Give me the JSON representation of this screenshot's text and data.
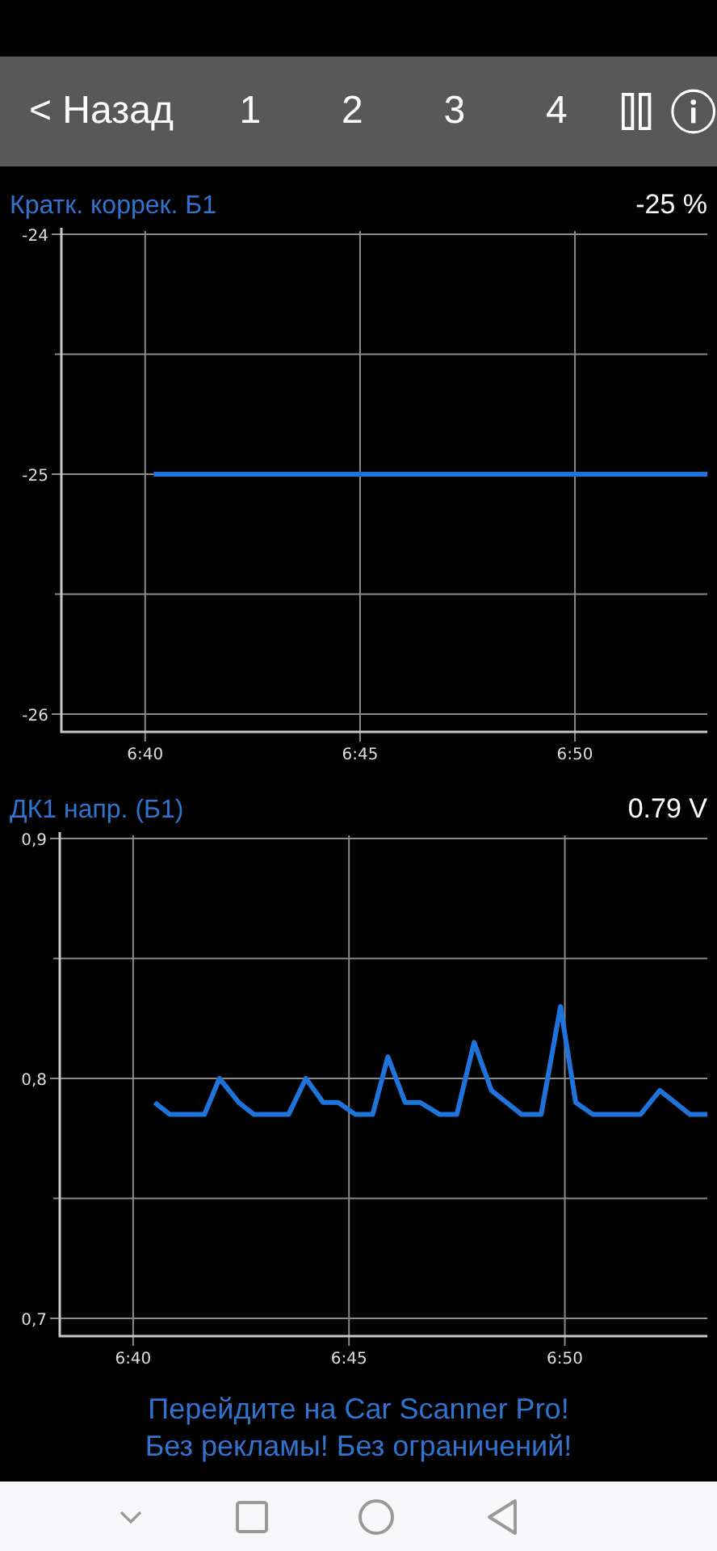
{
  "toolbar": {
    "back": "< Назад",
    "pages": [
      {
        "label": "1"
      },
      {
        "label": "2"
      },
      {
        "label": "3"
      },
      {
        "label": "4"
      }
    ]
  },
  "charts": [
    {
      "title": "Кратк. коррек. Б1",
      "reading": "-25 %",
      "chart_data": {
        "type": "line",
        "xlim": [
          398.05,
          413.08
        ],
        "ylim": [
          -26.074,
          -23.973
        ],
        "xticks": [
          {
            "value": 400,
            "label": "6:40"
          },
          {
            "value": 405,
            "label": "6:45"
          },
          {
            "value": 410,
            "label": "6:50"
          }
        ],
        "yticks": [
          {
            "value": -24,
            "label": "-24"
          },
          {
            "value": -25,
            "label": "-25"
          },
          {
            "value": -26,
            "label": "-26"
          }
        ],
        "x": [
          400.2,
          413.08
        ],
        "grid": true,
        "series": [
          {
            "color": "#1f74dc",
            "values": [
              -25,
              -25
            ]
          }
        ]
      }
    },
    {
      "title": "ДК1 напр. (Б1)",
      "reading": "0.79 V",
      "chart_data": {
        "type": "line",
        "xlim": [
          398.3,
          413.3
        ],
        "ylim": [
          0.6926,
          0.9027
        ],
        "xticks": [
          {
            "value": 400,
            "label": "6:40"
          },
          {
            "value": 405,
            "label": "6:45"
          },
          {
            "value": 410,
            "label": "6:50"
          }
        ],
        "yticks": [
          {
            "value": 0.9,
            "label": "0,9"
          },
          {
            "value": 0.8,
            "label": "0,8"
          },
          {
            "value": 0.7,
            "label": "0,7"
          }
        ],
        "x": [
          400.5,
          400.85,
          401.65,
          402.0,
          402.45,
          402.8,
          403.6,
          404.0,
          404.4,
          404.75,
          405.15,
          405.55,
          405.9,
          406.3,
          406.65,
          407.1,
          407.5,
          407.9,
          408.3,
          409.0,
          409.45,
          409.9,
          410.25,
          410.65,
          411.75,
          412.2,
          412.9,
          413.3
        ],
        "grid": true,
        "series": [
          {
            "color": "#1f74dc",
            "values": [
              0.79,
              0.785,
              0.785,
              0.8,
              0.79,
              0.785,
              0.785,
              0.8,
              0.79,
              0.79,
              0.785,
              0.785,
              0.809,
              0.79,
              0.79,
              0.785,
              0.785,
              0.815,
              0.795,
              0.785,
              0.785,
              0.83,
              0.79,
              0.785,
              0.785,
              0.795,
              0.785,
              0.785
            ]
          }
        ]
      }
    }
  ],
  "promo": [
    "Перейдите на Car Scanner Pro!",
    "Без рекламы! Без ограничений!"
  ]
}
